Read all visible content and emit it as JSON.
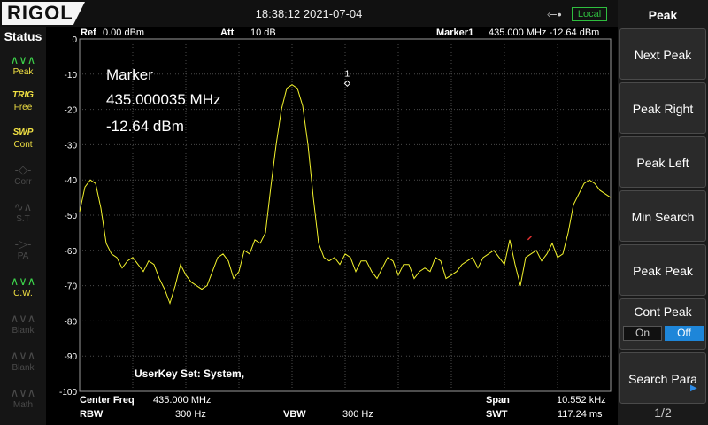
{
  "header": {
    "logo": "RIGOL",
    "datetime": "18:38:12 2021-07-04",
    "usb_icon": "usb-icon",
    "local_label": "Local"
  },
  "status": {
    "title": "Status",
    "items": [
      {
        "icon": "peak-icon",
        "label": "Peak",
        "active": true
      },
      {
        "icon": "trig-icon",
        "top": "TRIG",
        "label": "Free",
        "active": true
      },
      {
        "icon": "swp-icon",
        "top": "SWP",
        "label": "Cont",
        "active": true
      },
      {
        "icon": "corr-icon",
        "label": "Corr",
        "active": false
      },
      {
        "icon": "st-icon",
        "label": "S.T",
        "active": false
      },
      {
        "icon": "pa-icon",
        "label": "PA",
        "active": false
      },
      {
        "icon": "cw-icon",
        "label": "C.W.",
        "active": true
      },
      {
        "icon": "blank-icon",
        "label": "Blank",
        "active": false
      },
      {
        "icon": "blank-icon",
        "label": "Blank",
        "active": false
      },
      {
        "icon": "math-icon",
        "label": "Math",
        "active": false
      }
    ]
  },
  "menu": {
    "title": "Peak",
    "buttons": [
      "Next Peak",
      "Peak Right",
      "Peak Left",
      "Min Search",
      "Peak Peak"
    ],
    "cont_peak": {
      "label": "Cont Peak",
      "on": "On",
      "off": "Off",
      "selected": "Off"
    },
    "search_para": "Search Para",
    "page": "1/2"
  },
  "readout": {
    "ref_label": "Ref",
    "ref_value": "0.00 dBm",
    "att_label": "Att",
    "att_value": "10 dB",
    "marker_label": "Marker1",
    "marker_value": "435.000 MHz  -12.64 dBm"
  },
  "marker_box": {
    "title": "Marker",
    "freq": "435.000035 MHz",
    "level": "-12.64 dBm",
    "tag": "1"
  },
  "userkey": "UserKey Set:   System,",
  "footer": {
    "center_label": "Center Freq",
    "center_value": "435.000 MHz",
    "span_label": "Span",
    "span_value": "10.552 kHz",
    "rbw_label": "RBW",
    "rbw_value": "300 Hz",
    "vbw_label": "VBW",
    "vbw_value": "300 Hz",
    "swt_label": "SWT",
    "swt_value": "117.24 ms"
  },
  "colors": {
    "trace": "#f3f32c",
    "grid": "#4a4a4a",
    "active": "#f0e043",
    "accent": "#1e86d9",
    "marker_peak": "#e03131"
  },
  "chart_data": {
    "type": "line",
    "yticks": [
      "0",
      "-10",
      "-20",
      "-30",
      "-40",
      "-50",
      "-60",
      "-70",
      "-80",
      "-90",
      "-100"
    ],
    "ylim": [
      -100,
      0
    ],
    "xlim": [
      0,
      100
    ],
    "x_units": "% of span",
    "grid": true,
    "series": [
      {
        "x": [
          0,
          1,
          2,
          3,
          4,
          5,
          6,
          7,
          8,
          9,
          10,
          11,
          12,
          13,
          14,
          15,
          16,
          17,
          18,
          19,
          20,
          21,
          22,
          23,
          24,
          25,
          26,
          27,
          28,
          29,
          30,
          31,
          32,
          33,
          34,
          35,
          36,
          37,
          38,
          39,
          40,
          41,
          42,
          43,
          44,
          45,
          46,
          47,
          48,
          49,
          50,
          51,
          52,
          53,
          54,
          55,
          56,
          57,
          58,
          59,
          60,
          61,
          62,
          63,
          64,
          65,
          66,
          67,
          68,
          69,
          70,
          71,
          72,
          73,
          74,
          75,
          76,
          77,
          78,
          79,
          80,
          81,
          82,
          83,
          84,
          85,
          86,
          87,
          88,
          89,
          90,
          91,
          92,
          93,
          94,
          95,
          96,
          97,
          98,
          99,
          100
        ],
        "y": [
          -49,
          -42,
          -40,
          -41,
          -48,
          -58,
          -61,
          -62,
          -65,
          -63,
          -62,
          -64,
          -66,
          -63,
          -64,
          -68,
          -71,
          -75,
          -70,
          -64,
          -67,
          -69,
          -70,
          -71,
          -70,
          -66,
          -62,
          -61,
          -63,
          -68,
          -66,
          -60,
          -61,
          -57,
          -58,
          -55,
          -42,
          -30,
          -20,
          -14,
          -13,
          -14,
          -19,
          -30,
          -45,
          -58,
          -62,
          -63,
          -62,
          -64,
          -61,
          -62,
          -66,
          -63,
          -63,
          -66,
          -68,
          -65,
          -62,
          -63,
          -67,
          -64,
          -64,
          -68,
          -66,
          -65,
          -66,
          -62,
          -63,
          -68,
          -67,
          -66,
          -64,
          -63,
          -62,
          -65,
          -62,
          -61,
          -60,
          -62,
          -64,
          -57,
          -64,
          -70,
          -62,
          -61,
          -60,
          -63,
          -61,
          -58,
          -62,
          -61,
          -55,
          -47,
          -44,
          -41,
          -40,
          -41,
          -43,
          -44,
          -45
        ]
      }
    ],
    "marker": {
      "x": 50.4,
      "y": -12.64,
      "label": "1"
    },
    "spur": {
      "x": 84.4,
      "y": -57
    }
  }
}
